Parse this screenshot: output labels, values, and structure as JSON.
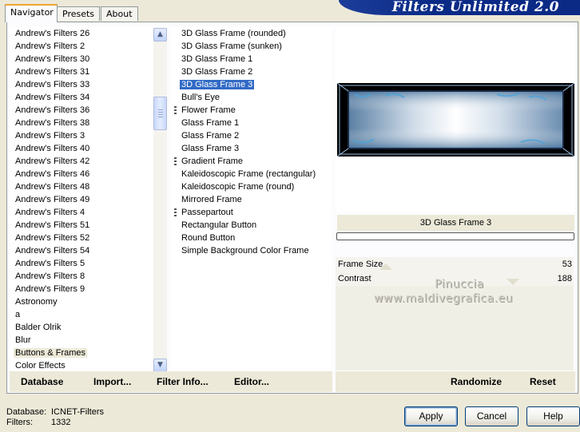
{
  "app_title": "Filters Unlimited 2.0",
  "tabs": [
    "Navigator",
    "Presets",
    "About"
  ],
  "categories": {
    "items": [
      "Andrew's Filters 26",
      "Andrew's Filters 2",
      "Andrew's Filters 30",
      "Andrew's Filters 31",
      "Andrew's Filters 33",
      "Andrew's Filters 34",
      "Andrew's Filters 36",
      "Andrew's Filters 38",
      "Andrew's Filters 3",
      "Andrew's Filters 40",
      "Andrew's Filters 42",
      "Andrew's Filters 46",
      "Andrew's Filters 48",
      "Andrew's Filters 49",
      "Andrew's Filters 4",
      "Andrew's Filters 51",
      "Andrew's Filters 52",
      "Andrew's Filters 54",
      "Andrew's Filters 5",
      "Andrew's Filters 8",
      "Andrew's Filters 9",
      "Astronomy",
      "a",
      "Balder Olrik",
      "Blur",
      "Buttons & Frames",
      "Color Effects"
    ],
    "highlighted": "Buttons & Frames"
  },
  "filters": {
    "items": [
      "3D Glass Frame (rounded)",
      "3D Glass Frame (sunken)",
      "3D Glass Frame 1",
      "3D Glass Frame 2",
      "3D Glass Frame 3",
      "Bull's Eye",
      "Flower Frame",
      "Glass Frame 1",
      "Glass Frame 2",
      "Glass Frame 3",
      "Gradient Frame",
      "Kaleidoscopic Frame (rectangular)",
      "Kaleidoscopic Frame (round)",
      "Mirrored Frame",
      "Passepartout",
      "Rectangular Button",
      "Round Button",
      "Simple Background Color Frame"
    ],
    "selected": "3D Glass Frame 3",
    "marked": [
      "Flower Frame",
      "Gradient Frame",
      "Passepartout"
    ]
  },
  "filter_name": "3D Glass Frame 3",
  "params": [
    {
      "label": "Frame Size",
      "value": "53"
    },
    {
      "label": "Contrast",
      "value": "188"
    }
  ],
  "watermark": [
    "Pinuccia",
    "www.maldivegrafica.eu"
  ],
  "links": {
    "database": "Database",
    "import": "Import...",
    "filter_info": "Filter Info...",
    "editor": "Editor...",
    "randomize": "Randomize",
    "reset": "Reset"
  },
  "status": {
    "database_label": "Database:",
    "database_value": "ICNET-Filters",
    "filters_label": "Filters:",
    "filters_value": "1332"
  },
  "buttons": {
    "apply": "Apply",
    "cancel": "Cancel",
    "help": "Help"
  },
  "colors": {
    "selection": "#316ac5",
    "banner": "#0a2a86",
    "tab_accent": "#f1a533"
  }
}
